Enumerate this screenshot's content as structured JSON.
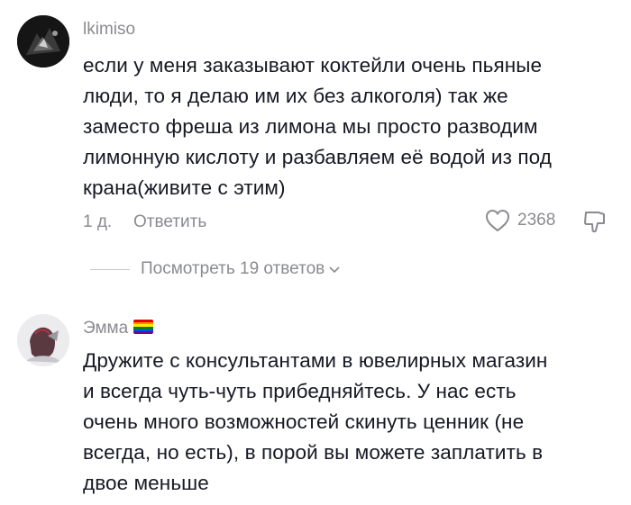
{
  "comments": [
    {
      "username": "lkimiso",
      "lines": [
        "если у меня заказывают коктейли очень пьяные",
        "люди, то я делаю им их без алкоголя) так же",
        "заместо фреша из лимона мы просто разводим",
        "лимонную кислоту и разбавляем её водой из под",
        "крана(живите с этим)"
      ],
      "time": "1 д.",
      "reply_label": "Ответить",
      "likes": "2368",
      "view_replies": "Посмотреть 19 ответов"
    },
    {
      "username": "Эмма",
      "badge_icon": "rainbow-flag-icon",
      "lines": [
        "Дружите с консультантами в ювелирных магазин",
        "и всегда чуть-чуть прибедняйтесь. У нас есть",
        "очень много возможностей скинуть ценник (не",
        "всегда, но есть), в порой вы можете заплатить в",
        "двое меньше"
      ]
    }
  ],
  "icons": {
    "like": "heart-outline-icon",
    "dislike": "thumb-down-icon",
    "chevron": "chevron-down-icon"
  },
  "colors": {
    "text": "#161823",
    "muted": "#8a8b91",
    "background": "#ffffff"
  }
}
